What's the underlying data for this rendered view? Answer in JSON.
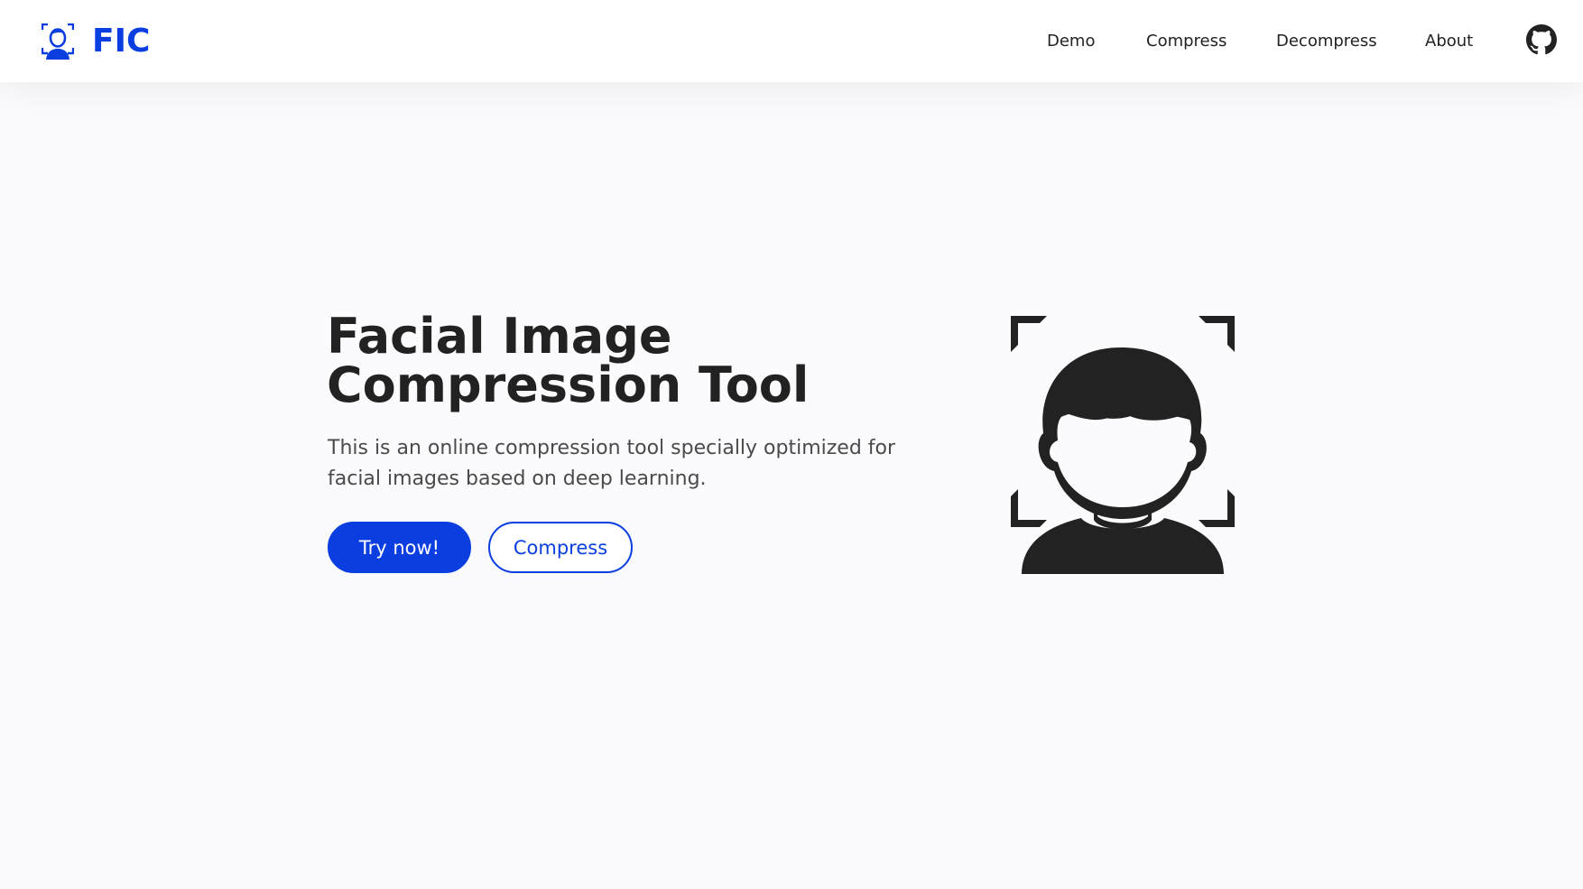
{
  "navbar": {
    "brand": {
      "logo_icon": "face-scan-icon",
      "name": "FIC"
    },
    "links": [
      {
        "label": "Demo"
      },
      {
        "label": "Compress"
      },
      {
        "label": "Decompress"
      },
      {
        "label": "About"
      }
    ],
    "github_icon": "github-icon"
  },
  "hero": {
    "title_line1": "Facial Image",
    "title_line2": "Compression Tool",
    "description": "This is an online compression tool specially optimized for facial images based on deep learning.",
    "primary_button": "Try now!",
    "secondary_button": "Compress",
    "illustration_icon": "face-recognition-icon"
  },
  "colors": {
    "brand": "#0b3ee0",
    "text": "#222222",
    "muted_text": "#4a4a4a",
    "background": "#fbfbfd"
  }
}
